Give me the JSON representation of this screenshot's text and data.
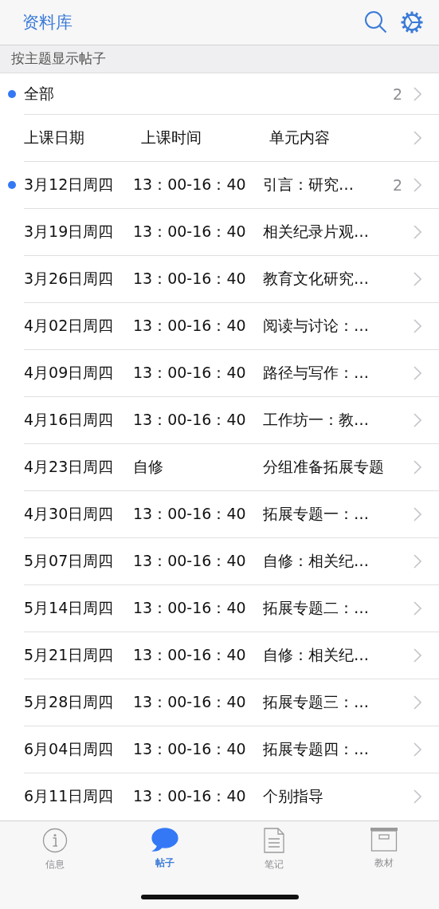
{
  "header": {
    "title": "资料库"
  },
  "section": {
    "title": "按主题显示帖子"
  },
  "all_row": {
    "label": "全部",
    "unread": true,
    "count": "2"
  },
  "column_headers": [
    "上课日期",
    "上课时间",
    "单元内容"
  ],
  "rows": [
    {
      "date": "3月12日周四",
      "time": "13：00-16：40",
      "topic": "引言：研究…",
      "unread": true,
      "count": "2"
    },
    {
      "date": "3月19日周四",
      "time": "13：00-16：40",
      "topic": "相关纪录片观…",
      "unread": false
    },
    {
      "date": "3月26日周四",
      "time": "13：00-16：40",
      "topic": "教育文化研究…",
      "unread": false
    },
    {
      "date": "4月02日周四",
      "time": "13：00-16：40",
      "topic": "阅读与讨论：…",
      "unread": false
    },
    {
      "date": "4月09日周四",
      "time": "13：00-16：40",
      "topic": "路径与写作：…",
      "unread": false
    },
    {
      "date": "4月16日周四",
      "time": "13：00-16：40",
      "topic": "工作坊一：教…",
      "unread": false
    },
    {
      "date": "4月23日周四",
      "time": "自修",
      "topic": "分组准备拓展专题",
      "unread": false
    },
    {
      "date": "4月30日周四",
      "time": "13：00-16：40",
      "topic": "拓展专题一：…",
      "unread": false
    },
    {
      "date": "5月07日周四",
      "time": "13：00-16：40",
      "topic": "自修：相关纪…",
      "unread": false
    },
    {
      "date": "5月14日周四",
      "time": "13：00-16：40",
      "topic": "拓展专题二：…",
      "unread": false
    },
    {
      "date": "5月21日周四",
      "time": "13：00-16：40",
      "topic": "自修：相关纪…",
      "unread": false
    },
    {
      "date": "5月28日周四",
      "time": "13：00-16：40",
      "topic": "拓展专题三：…",
      "unread": false
    },
    {
      "date": "6月04日周四",
      "time": "13：00-16：40",
      "topic": "拓展专题四：…",
      "unread": false
    },
    {
      "date": "6月11日周四",
      "time": "13：00-16：40",
      "topic": "个别指导",
      "unread": false
    }
  ],
  "tabs": [
    {
      "kind": "info",
      "label": "信息",
      "selected": false
    },
    {
      "kind": "posts",
      "label": "帖子",
      "selected": true
    },
    {
      "kind": "notes",
      "label": "笔记",
      "selected": false
    },
    {
      "kind": "materials",
      "label": "教材",
      "selected": false
    }
  ]
}
